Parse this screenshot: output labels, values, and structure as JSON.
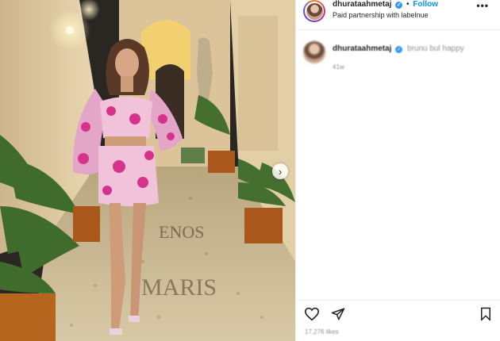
{
  "post": {
    "author": {
      "username": "dhurataahmetaj",
      "verified": true,
      "follow_label": "Follow",
      "separator": "•",
      "subtitle": "Paid partnership with labelnue"
    },
    "media": {
      "description_icon": "photo",
      "sign_text_top": "ENOS",
      "sign_text_bottom": "MARIS",
      "next_icon": "chevron-right-icon",
      "next_glyph": "›"
    },
    "caption": {
      "username": "dhurataahmetaj",
      "text": "brunu bul happy",
      "time": "41w"
    },
    "actions": {
      "like_icon": "heart-icon",
      "share_icon": "paper-plane-icon",
      "save_icon": "bookmark-icon",
      "likes_text": "17,276 likes"
    },
    "more_label": "•••"
  },
  "colors": {
    "accent": "#0095f6",
    "verified": "#3897f0",
    "muted": "#8e8e8e",
    "dress_pink": "#d6338a"
  }
}
